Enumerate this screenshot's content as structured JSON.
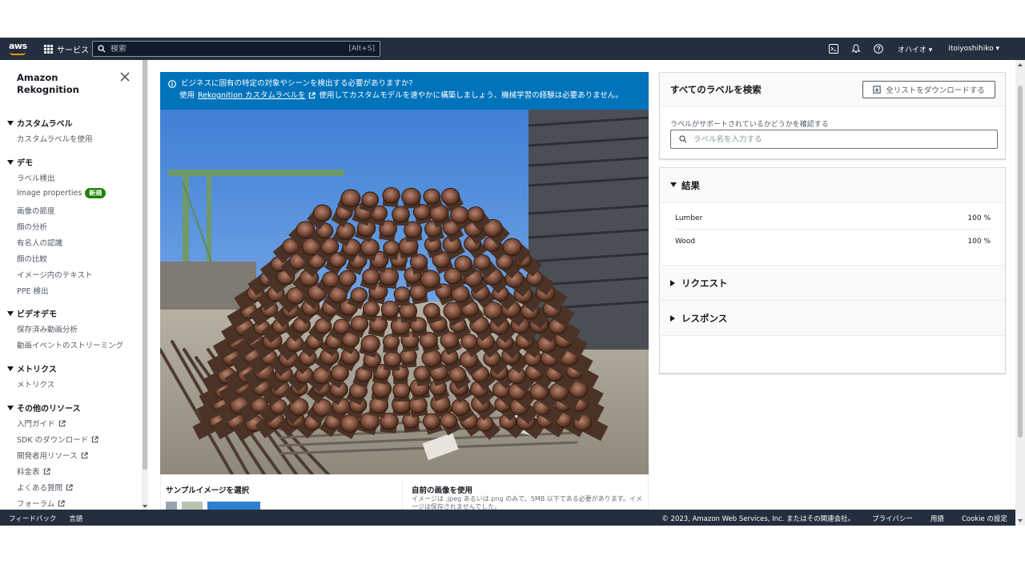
{
  "topnav": {
    "logo_text": "aws",
    "services_label": "サービス",
    "search_placeholder": "検索",
    "search_shortcut": "[Alt+S]",
    "region": "オハイオ ▾",
    "user": "itoiyoshihiko ▾"
  },
  "sidebar": {
    "title_line1": "Amazon",
    "title_line2": "Rekognition",
    "sections": [
      {
        "label": "カスタムラベル",
        "items": [
          "カスタムラベルを使用"
        ]
      },
      {
        "label": "デモ",
        "items": [
          "ラベル検出",
          "Image properties",
          "画像の節度",
          "顔の分析",
          "有名人の認識",
          "顔の比較",
          "イメージ内のテキスト",
          "PPE 検出"
        ]
      },
      {
        "label": "ビデオデモ",
        "items": [
          "保存済み動画分析",
          "動画イベントのストリーミング"
        ]
      },
      {
        "label": "メトリクス",
        "items": [
          "メトリクス"
        ]
      },
      {
        "label": "その他のリソース",
        "items": [
          "入門ガイド",
          "SDK のダウンロード",
          "開発者用リソース",
          "料金表",
          "よくある質問",
          "フォーラム"
        ]
      }
    ],
    "new_badge": "新規"
  },
  "banner": {
    "line1": "ビジネスに固有の特定の対象やシーンを検出する必要がありますか?",
    "line2_prefix": "使用",
    "link": "Rekognition カスタムラベルを",
    "line2_suffix": "使用してカスタムモデルを速やかに構築しましょう、機械学習の経験は必要ありません。"
  },
  "image_area": {
    "sample_heading": "サンプルイメージを選択",
    "own_heading": "自前の画像を使用",
    "own_desc": "イメージは .jpeg あるいは.png のみで、5MB 以下である必要があります。イメージは保存されませんでした。"
  },
  "label_search": {
    "title": "すべてのラベルを検索",
    "download_button": "全リストをダウンロードする",
    "field_label": "ラベルがサポートされているかどうかを確認する",
    "placeholder": "ラベル名を入力する"
  },
  "results": {
    "heading": "結果",
    "rows": [
      {
        "name": "Lumber",
        "value": "100 %"
      },
      {
        "name": "Wood",
        "value": "100 %"
      }
    ],
    "request_heading": "リクエスト",
    "response_heading": "レスポンス"
  },
  "footer": {
    "feedback": "フィードバック",
    "language": "言語",
    "copyright": "© 2023, Amazon Web Services, Inc. またはその関連会社。",
    "privacy": "プライバシー",
    "terms": "用語",
    "cookie": "Cookie の設定"
  },
  "colors": {
    "nav_bg": "#232f3e",
    "banner_bg": "#0073bb",
    "badge_green": "#1d8102",
    "accent_orange": "#ff9900"
  }
}
